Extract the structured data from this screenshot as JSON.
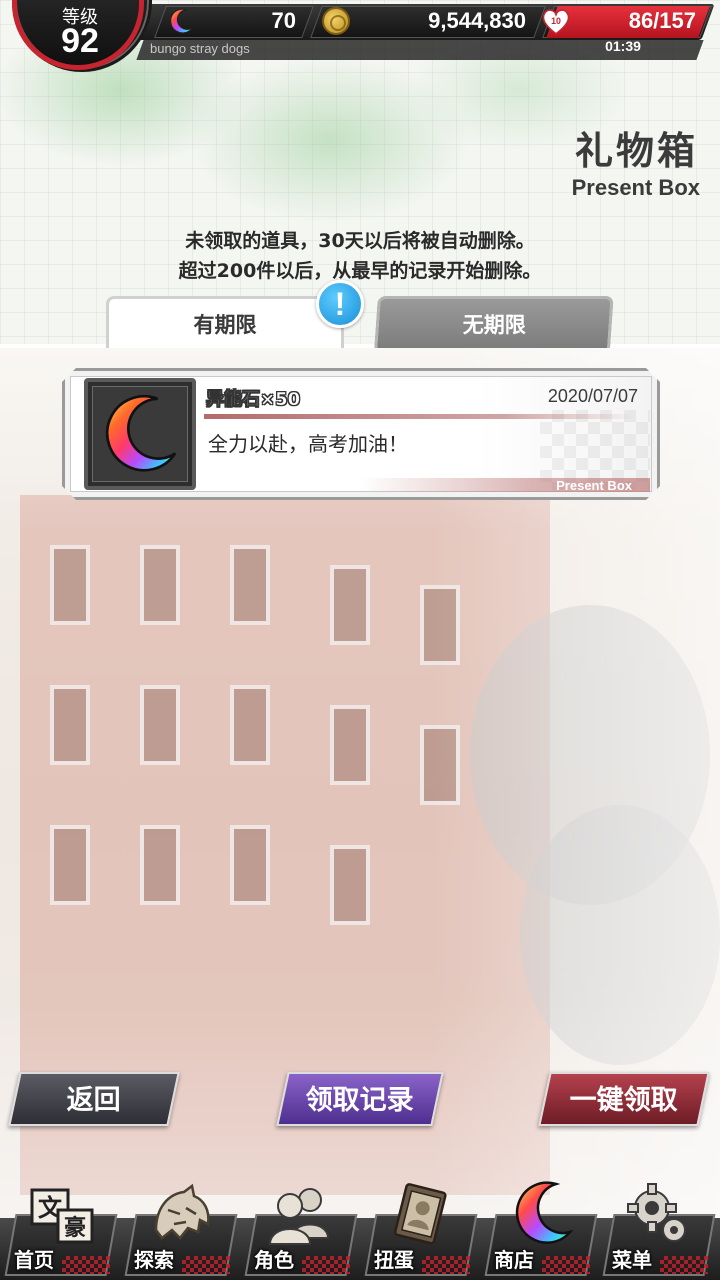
{
  "status": {
    "level_label": "等级",
    "level": "92",
    "stone_count": "70",
    "coins": "9,544,830",
    "stamina": "86/157",
    "timer": "01:39",
    "app_name": "bungo stray dogs"
  },
  "header": {
    "title": "礼物箱",
    "subtitle": "Present Box",
    "notice_line1": "未领取的道具，30天以后将被自动删除。",
    "notice_line2": "超过200件以后，从最早的记录开始删除。"
  },
  "tabs": [
    {
      "label": "有期限",
      "active": true
    },
    {
      "label": "无期限",
      "active": false
    }
  ],
  "alert_badge": "!",
  "presents": [
    {
      "name": "异能石×50",
      "date": "2020/07/07",
      "message": "全力以赴，高考加油！",
      "footer": "Present Box",
      "icon": "ability-stone-icon"
    }
  ],
  "actions": {
    "back": "返回",
    "history": "领取记录",
    "claim_all": "一键领取"
  },
  "nav": [
    {
      "label": "首页",
      "icon": "home-icon"
    },
    {
      "label": "探索",
      "icon": "explore-tiger-icon"
    },
    {
      "label": "角色",
      "icon": "characters-icon"
    },
    {
      "label": "扭蛋",
      "icon": "gacha-book-icon"
    },
    {
      "label": "商店",
      "icon": "shop-stone-icon"
    },
    {
      "label": "菜单",
      "icon": "menu-gear-icon"
    }
  ],
  "colors": {
    "accent_red": "#c6242f",
    "history_purple": "#6a47ad",
    "alert_blue": "#1a8fd6"
  }
}
